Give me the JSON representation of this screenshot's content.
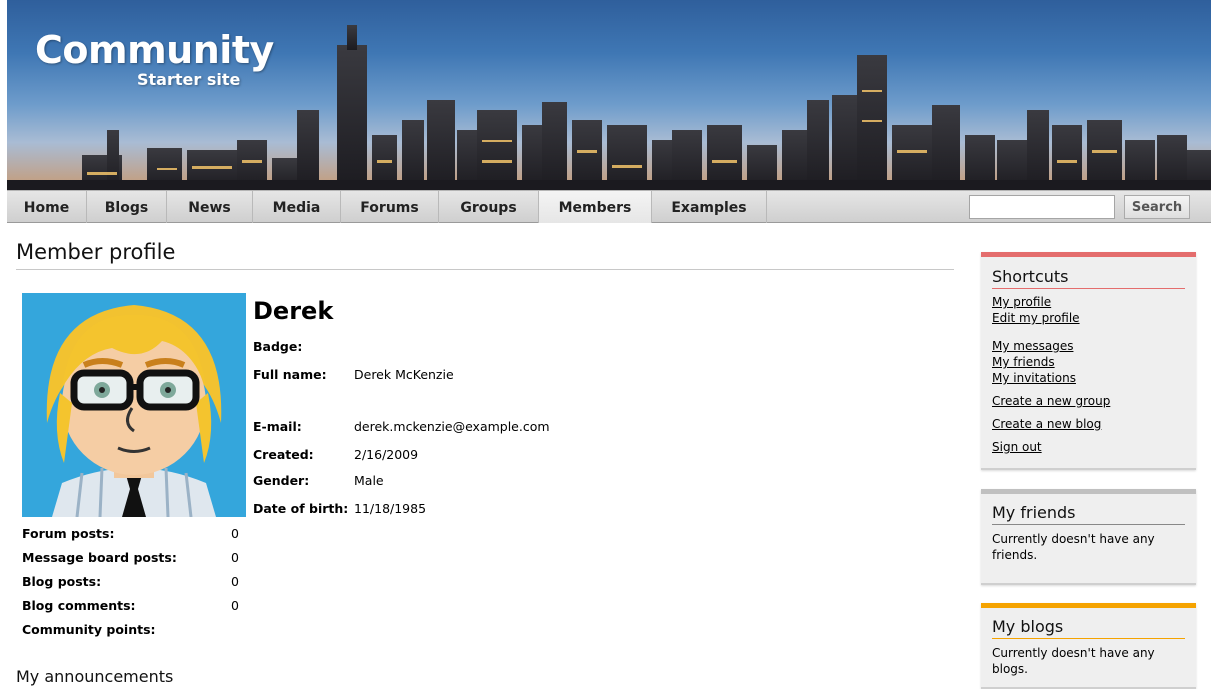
{
  "site": {
    "logo_title": "Community",
    "logo_subtitle": "Starter site"
  },
  "nav": {
    "items": [
      {
        "label": "Home"
      },
      {
        "label": "Blogs"
      },
      {
        "label": "News"
      },
      {
        "label": "Media"
      },
      {
        "label": "Forums"
      },
      {
        "label": "Groups"
      },
      {
        "label": "Members",
        "active": true
      },
      {
        "label": "Examples"
      }
    ],
    "search_value": "",
    "search_button": "Search"
  },
  "page": {
    "title": "Member profile"
  },
  "profile": {
    "name": "Derek",
    "fields": {
      "badge_label": "Badge:",
      "badge_value": "",
      "fullname_label": "Full name:",
      "fullname_value": "Derek McKenzie",
      "email_label": "E-mail:",
      "email_value": "derek.mckenzie@example.com",
      "created_label": "Created:",
      "created_value": "2/16/2009",
      "gender_label": "Gender:",
      "gender_value": "Male",
      "dob_label": "Date of birth:",
      "dob_value": "11/18/1985"
    },
    "stats": [
      {
        "label": "Forum posts:",
        "value": "0"
      },
      {
        "label": "Message board posts:",
        "value": "0"
      },
      {
        "label": "Blog posts:",
        "value": "0"
      },
      {
        "label": "Blog comments:",
        "value": "0"
      },
      {
        "label": "Community points:",
        "value": ""
      }
    ],
    "announcements_title": "My announcements"
  },
  "sidebar": {
    "shortcuts": {
      "title": "Shortcuts",
      "accent": "#e46d6d",
      "links": [
        "My profile",
        "Edit my profile",
        "My messages",
        "My friends",
        "My invitations",
        "Create a new group",
        "Create a new blog",
        "Sign out"
      ]
    },
    "friends": {
      "title": "My friends",
      "accent": "#c0c0c0",
      "text": "Currently doesn't have any friends."
    },
    "blogs": {
      "title": "My blogs",
      "accent": "#f5a300",
      "text": "Currently doesn't have any blogs."
    }
  }
}
